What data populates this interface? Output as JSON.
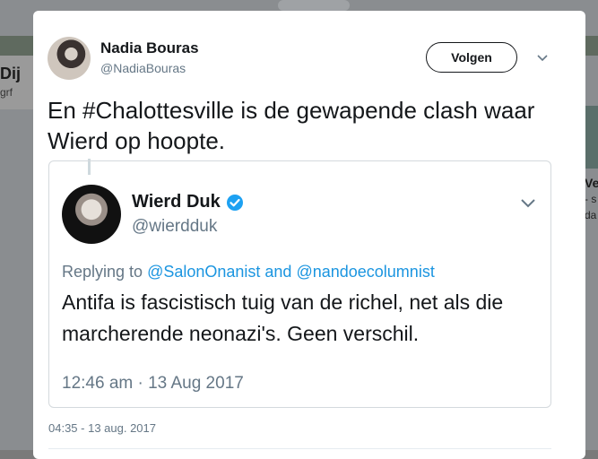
{
  "background": {
    "left_snippet": "Dij",
    "left_sub": "grf",
    "right_snippet": "Ve",
    "right_lines": [
      "- s",
      "da"
    ]
  },
  "tweet": {
    "author_name": "Nadia Bouras",
    "author_handle": "@NadiaBouras",
    "follow_label": "Volgen",
    "text": "En #Chalottesville is de gewapende clash waar Wierd op hoopte.",
    "timestamp": "04:35 - 13 aug. 2017"
  },
  "quoted_tweet": {
    "author_name": "Wierd Duk",
    "author_handle": "@wierdduk",
    "replying_prefix": "Replying to ",
    "mention1": "@SalonOnanist",
    "and_word": " and ",
    "mention2": "@nandoecolumnist",
    "text": "Antifa is fascistisch tuig van de richel, net als die marcherende neonazi's. Geen verschil.",
    "timestamp": "12:46 am · 13 Aug 2017"
  },
  "colors": {
    "link": "#1b95e0",
    "secondary_text": "#657786",
    "verified": "#1da1f2"
  }
}
